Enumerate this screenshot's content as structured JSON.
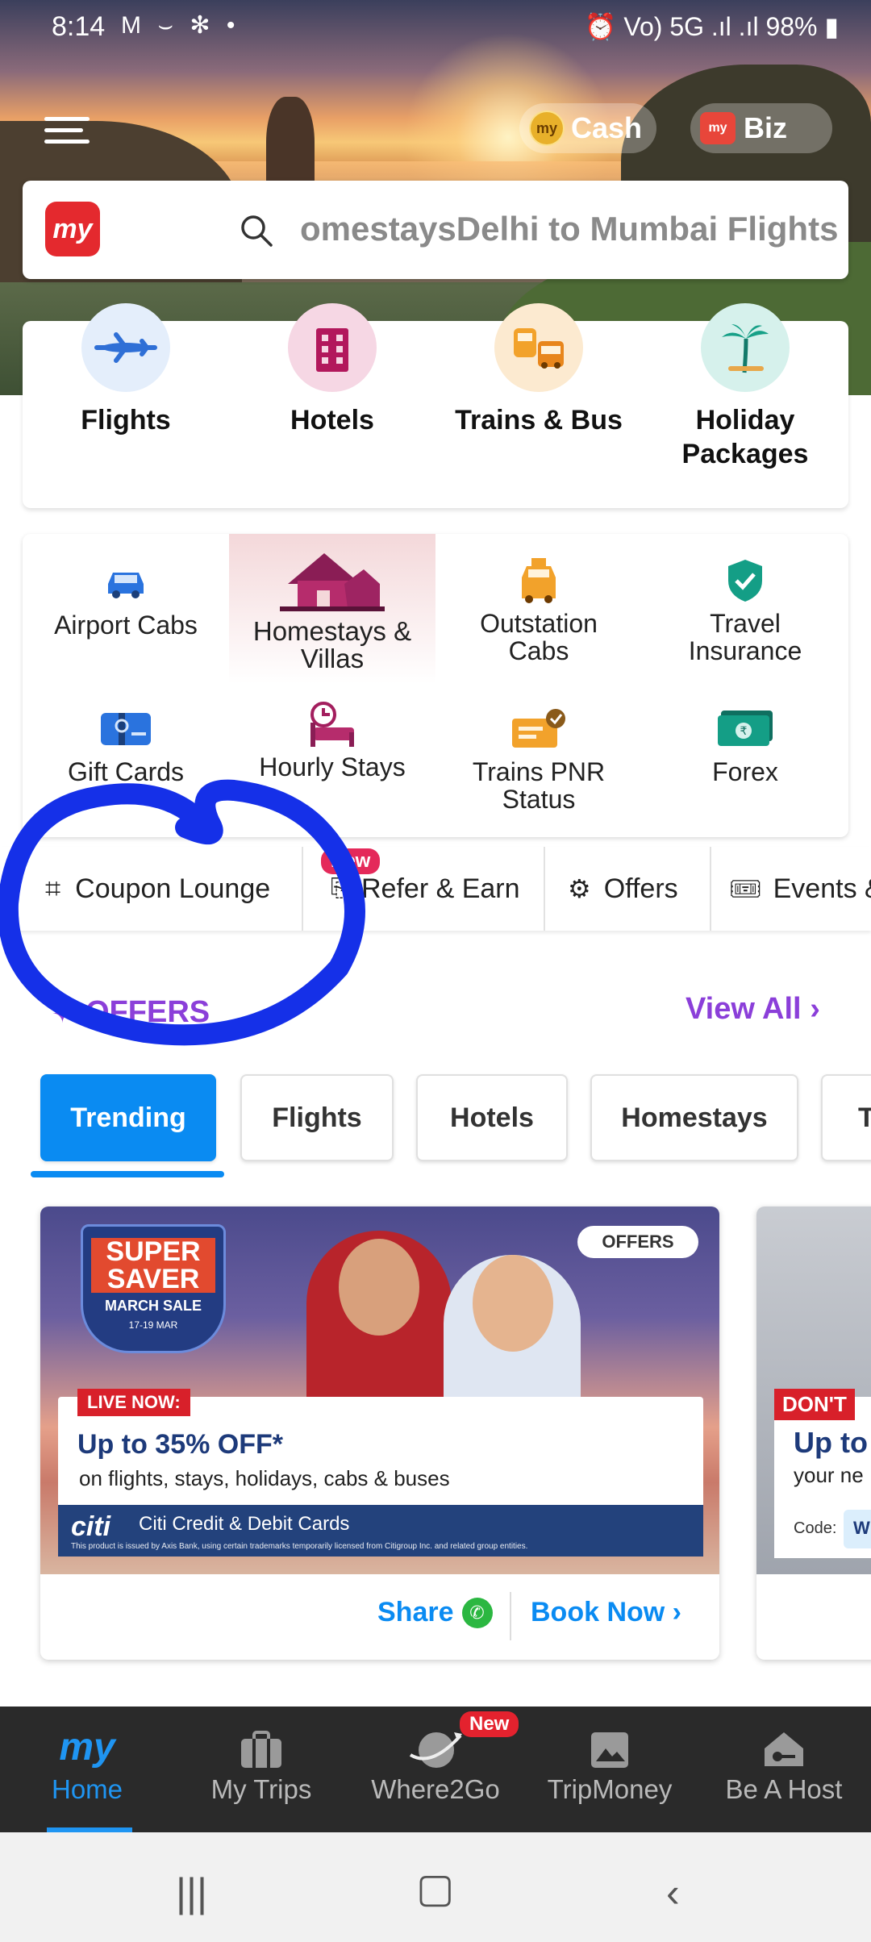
{
  "status_bar": {
    "time": "8:14",
    "left_icons": "M ⌣ ✻ •",
    "right_icons": "⏰ Vo) 5G .ıl .ıl",
    "battery": "98%"
  },
  "header": {
    "cash_label": "Cash",
    "coin_text": "my",
    "biz_label": "Biz",
    "bag_text": "my",
    "logo_text": "my",
    "search_text": "omestaysDelhi to Mumbai Flights"
  },
  "primary_categories": [
    {
      "label": "Flights",
      "icon": "plane-icon",
      "bg": "#e4eefb"
    },
    {
      "label": "Hotels",
      "icon": "hotel-icon",
      "bg": "#f6d7e4"
    },
    {
      "label": "Trains & Bus",
      "icon": "train-bus-icon",
      "bg": "#fcead0"
    },
    {
      "label": "Holiday Packages",
      "icon": "palm-tree-icon",
      "bg": "#d6f1ec"
    }
  ],
  "secondary_grid": [
    {
      "label": "Airport Cabs",
      "icon": "car-icon"
    },
    {
      "label": "Homestays & Villas",
      "icon": "house-icon"
    },
    {
      "label": "Outstation Cabs",
      "icon": "taxi-icon"
    },
    {
      "label": "Travel Insurance",
      "icon": "shield-icon"
    },
    {
      "label": "Gift Cards",
      "icon": "gift-card-icon"
    },
    {
      "label": "Hourly Stays",
      "icon": "clock-bed-icon"
    },
    {
      "label": "Trains PNR Status",
      "icon": "ticket-icon"
    },
    {
      "label": "Forex",
      "icon": "currency-note-icon"
    }
  ],
  "quick_links": [
    {
      "label": "Coupon Lounge",
      "icon": "coupon-icon"
    },
    {
      "label": "Refer & Earn",
      "icon": "refer-icon"
    },
    {
      "label": "Offers",
      "icon": "offer-percent-icon"
    },
    {
      "label": "Events &",
      "icon": "ticket-icon"
    }
  ],
  "new_badge": "New",
  "offers": {
    "title": "OFFERS",
    "view_all": "View All",
    "tabs": [
      "Trending",
      "Flights",
      "Hotels",
      "Homestays",
      "T"
    ]
  },
  "offer_card": {
    "saver_line1": "SUPER",
    "saver_line2": "SAVER",
    "saver_line3": "MARCH SALE",
    "saver_dates": "17-19 MAR",
    "chip": "OFFERS",
    "live_now": "LIVE NOW:",
    "headline": "Up to 35% OFF*",
    "subline": "on flights, stays, holidays, cabs & buses",
    "citi": "citi",
    "citi_cards": "Citi Credit & Debit Cards",
    "fine_print": "This product is issued by Axis Bank, using certain trademarks temporarily licensed from Citigroup Inc. and related group entities.",
    "share": "Share",
    "book_now": "Book Now"
  },
  "peek_card": {
    "tag": "DON'T",
    "headline": "Up to",
    "subline": "your ne",
    "code_label": "Code:",
    "code_value": "W"
  },
  "bottom_nav": [
    {
      "label": "Home",
      "icon": "my-logo-icon",
      "active": true
    },
    {
      "label": "My Trips",
      "icon": "suitcase-icon",
      "active": false
    },
    {
      "label": "Where2Go",
      "icon": "globe-plane-icon",
      "active": false
    },
    {
      "label": "TripMoney",
      "icon": "image-icon",
      "active": false
    },
    {
      "label": "Be A Host",
      "icon": "host-house-icon",
      "active": false
    }
  ],
  "bottom_nav_badge": "New",
  "colors": {
    "accent_blue": "#0a8bf2",
    "purple": "#8b3fd9",
    "brand_red": "#e4292e",
    "nav_dark": "#2a2a2a"
  }
}
